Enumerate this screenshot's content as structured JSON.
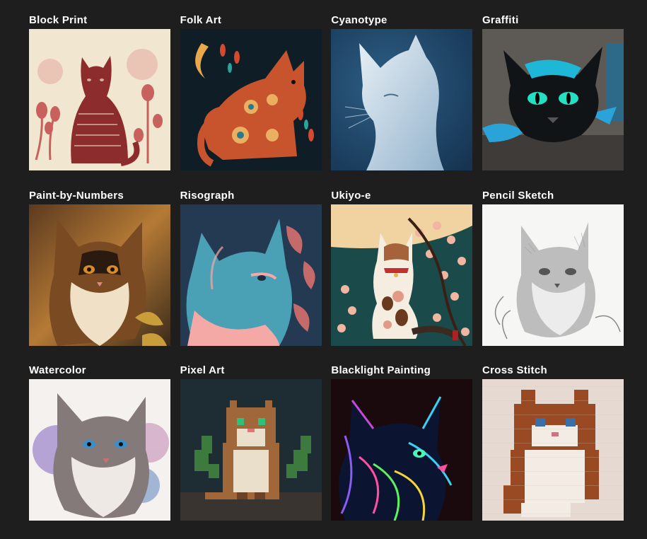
{
  "gallery": {
    "items": [
      {
        "label": "Block Print"
      },
      {
        "label": "Folk Art"
      },
      {
        "label": "Cyanotype"
      },
      {
        "label": "Graffiti"
      },
      {
        "label": "Paint-by-Numbers"
      },
      {
        "label": "Risograph"
      },
      {
        "label": "Ukiyo-e"
      },
      {
        "label": "Pencil Sketch"
      },
      {
        "label": "Watercolor"
      },
      {
        "label": "Pixel Art"
      },
      {
        "label": "Blacklight Painting"
      },
      {
        "label": "Cross Stitch"
      }
    ]
  }
}
